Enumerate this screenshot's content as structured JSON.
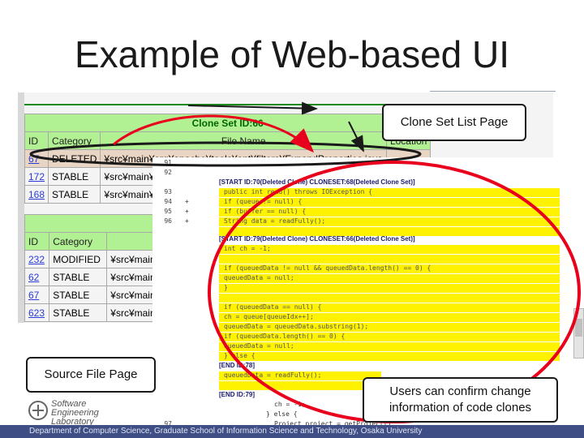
{
  "slide": {
    "title": "Example of Web-based UI",
    "footer": "Department of Computer Science, Graduate School of Information Science and Technology, Osaka University"
  },
  "callouts": {
    "clone_set_list": "Clone Set List Page",
    "source_file": "Source File Page",
    "users_line1": "Users can confirm change",
    "users_line2": "information of code clones"
  },
  "clone_set_table": {
    "title": "Clone Set ID:66",
    "headers": [
      "ID",
      "Category",
      "File Name",
      "Location"
    ],
    "rows": [
      {
        "id": "67",
        "category": "DELETED",
        "file": "¥src¥main¥org¥apache¥tools¥ant¥filters¥ExpandProperties.java",
        "loc": ""
      },
      {
        "id": "172",
        "category": "STABLE",
        "file": "¥src¥main¥o",
        "loc": ""
      },
      {
        "id": "168",
        "category": "STABLE",
        "file": "¥src¥main¥o",
        "loc": ""
      }
    ]
  },
  "second_table": {
    "headers": [
      "ID",
      "Category"
    ],
    "rows": [
      {
        "id": "232",
        "category": "MODIFIED",
        "file": "¥src¥main¥o"
      },
      {
        "id": "62",
        "category": "STABLE",
        "file": "¥src¥main¥o"
      },
      {
        "id": "67",
        "category": "STABLE",
        "file": "¥src¥main¥o"
      },
      {
        "id": "623",
        "category": "STABLE",
        "file": "¥src¥main¥o"
      }
    ]
  },
  "source_view": {
    "line_numbers": [
      "91",
      "92",
      "93",
      "94",
      "95",
      "96"
    ],
    "markers": [
      "",
      "",
      "",
      "+",
      "+",
      "+"
    ],
    "bottom_line_number": "97",
    "header1": "[START ID:70(Deleted Clone) CLONESET:68(Deleted Clone Set)]",
    "header2": "[START ID:79(Deleted Clone) CLONESET:66(Deleted Clone Set)]",
    "end1": "[END ID:78]",
    "end2": "[END ID:79]",
    "code_lines": [
      "public int read() throws IOException {",
      "  if (queue != null) {",
      "    if (buffer == null) {",
      "      String data = readFully();",
      "",
      "    int ch = -1;",
      "",
      "    if (queuedData != null && queuedData.length() == 0) {",
      "      queuedData = null;",
      "    }",
      "",
      "    if (queuedData == null) {",
      "      ch = queue[queueIdx++];",
      "      queuedData = queuedData.substring(1);",
      "      if (queuedData.length() == 0) {",
      "        queuedData = null;",
      "      }",
      "    }",
      "  } else {"
    ],
    "lower_code": [
      "queuedData = readFully();",
      "ch = -1;",
      "} else {",
      "Project project = getProject();"
    ]
  },
  "logo": {
    "line1": "Software",
    "line2": "Engineering",
    "line3": "Laboratory"
  },
  "colors": {
    "footer": "#3f4f86",
    "highlight": "#fff200",
    "table_header": "#b2f094",
    "ellipse": "#e8001c"
  }
}
